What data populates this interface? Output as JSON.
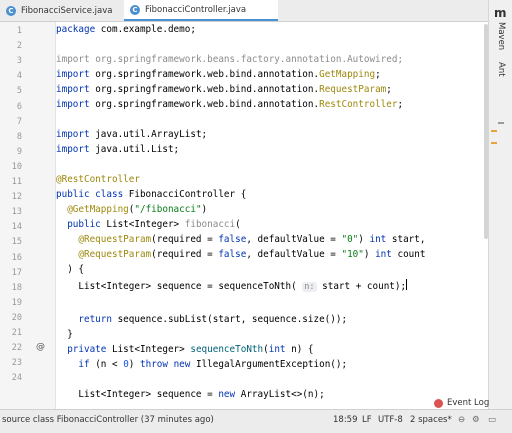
{
  "tabs": [
    {
      "label": "FibonacciService.java",
      "icon": "C"
    },
    {
      "label": "FibonacciController.java",
      "icon": "C"
    }
  ],
  "side_tools": {
    "top": "m",
    "maven": "Maven",
    "ant": "Ant"
  },
  "hint_label": "n:",
  "status": {
    "left": "source class FibonacciController (37 minutes ago)",
    "position": "18:59",
    "line_sep": "LF",
    "encoding": "UTF-8",
    "indent": "2 spaces*"
  },
  "event_log": "Event Log",
  "lines": [
    {
      "n": "1"
    },
    {
      "n": "2"
    },
    {
      "n": "3"
    },
    {
      "n": "4"
    },
    {
      "n": "5"
    },
    {
      "n": "6"
    },
    {
      "n": "7"
    },
    {
      "n": "8"
    },
    {
      "n": "9"
    },
    {
      "n": "10"
    },
    {
      "n": "11"
    },
    {
      "n": "12"
    },
    {
      "n": "13"
    },
    {
      "n": "14"
    },
    {
      "n": "15"
    },
    {
      "n": "16"
    },
    {
      "n": "17"
    },
    {
      "n": "18"
    },
    {
      "n": "19"
    },
    {
      "n": "20"
    },
    {
      "n": "21"
    },
    {
      "n": "22"
    },
    {
      "n": "23"
    },
    {
      "n": "24"
    }
  ],
  "code": {
    "l1a": "package",
    "l1b": " com.example.demo;",
    "l3a": "import",
    "l3b": " org.springframework.beans.factory.annotation.Autowired;",
    "l4a": "import",
    "l4b": " org.springframework.web.bind.annotation.",
    "l4c": "GetMapping",
    "l4d": ";",
    "l5a": "import",
    "l5b": " org.springframework.web.bind.annotation.",
    "l5c": "RequestParam",
    "l5d": ";",
    "l6a": "import",
    "l6b": " org.springframework.web.bind.annotation.",
    "l6c": "RestController",
    "l6d": ";",
    "l8a": "import",
    "l8b": " java.util.ArrayList;",
    "l9a": "import",
    "l9b": " java.util.List;",
    "l11": "@RestController",
    "l12a": "public class",
    "l12b": " FibonacciController {",
    "l13a": "  @GetMapping",
    "l13b": "(",
    "l13c": "\"/fibonacci\"",
    "l13d": ")",
    "l14a": "  public",
    "l14b": " List<Integer> ",
    "l14c": "fibonacci",
    "l14d": "(",
    "l15a": "    @RequestParam",
    "l15b": "(required = ",
    "l15c": "false",
    "l15d": ", defaultValue = ",
    "l15e": "\"0\"",
    "l15f": ") ",
    "l15g": "int",
    "l15h": " start,",
    "l16a": "    @RequestParam",
    "l16b": "(required = ",
    "l16c": "false",
    "l16d": ", defaultValue = ",
    "l16e": "\"10\"",
    "l16f": ") ",
    "l16g": "int",
    "l16h": " count",
    "l17": "  ) {",
    "l18a": "    List<Integer> sequence = seque",
    "l18b": "nceToNth( ",
    "l18c": " start + count);",
    "l20a": "    return",
    "l20b": " sequence.subList(start, sequence.size());",
    "l21": "  }",
    "l22a": "  private",
    "l22b": " List<Integer> ",
    "l22c": "sequenceToNth",
    "l22d": "(",
    "l22e": "int",
    "l22f": " n) {",
    "l23a": "    if",
    "l23b": " (n < ",
    "l23c": "0",
    "l23d": ") ",
    "l23e": "throw new",
    "l23f": " IllegalArgumentException();",
    "l25a": "    List<Integer> sequence = ",
    "l25b": "new",
    "l25c": " ArrayList<>(n);"
  }
}
